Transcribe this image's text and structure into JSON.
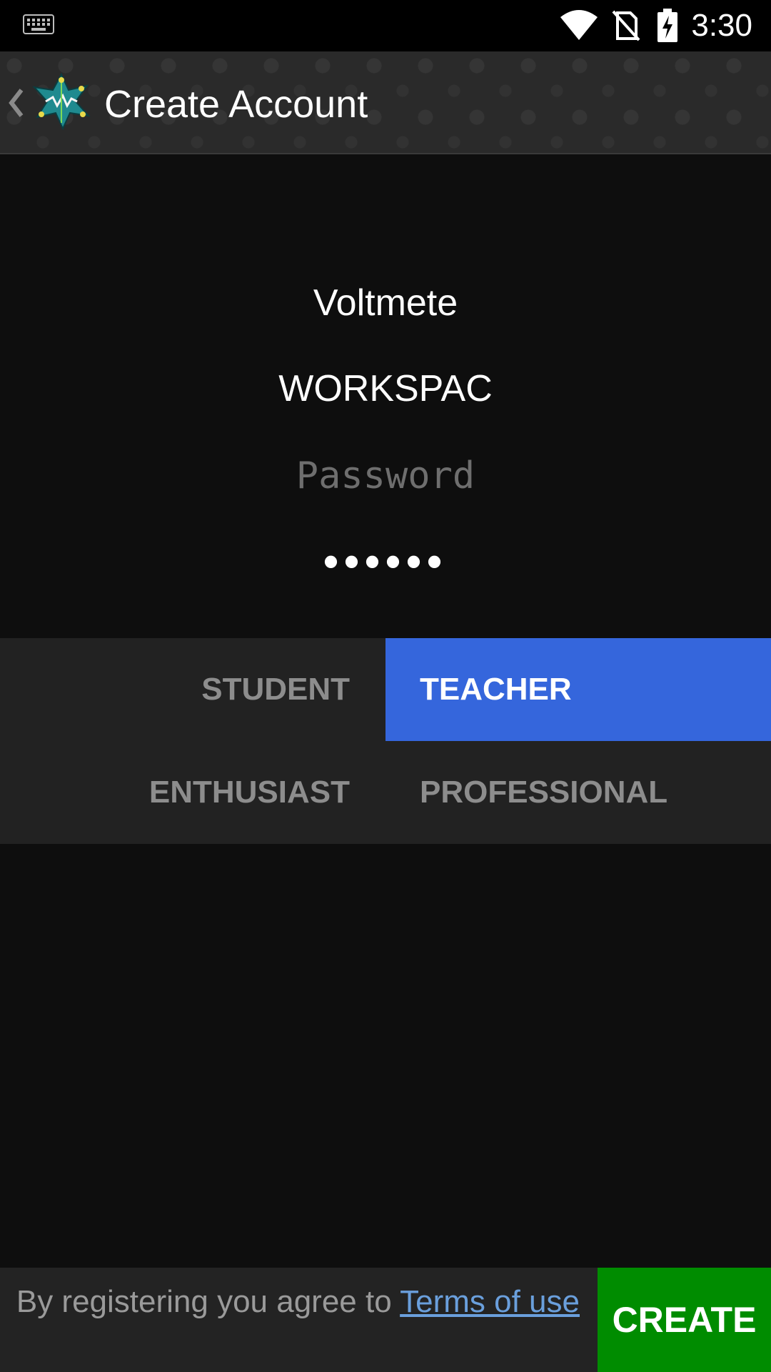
{
  "status_bar": {
    "time": "3:30",
    "icons": [
      "keyboard-icon",
      "wifi-icon",
      "no-sim-icon",
      "battery-charging-icon"
    ]
  },
  "app_bar": {
    "title": "Create Account",
    "back_icon": "chevron-left-icon",
    "logo_icon": "app-logo-icon"
  },
  "form": {
    "username_value": "Voltmete",
    "workspace_value": "WORKSPAC",
    "password_placeholder": "Password",
    "confirm_password_masked": "••••••"
  },
  "roles": {
    "items": [
      {
        "label": "STUDENT",
        "selected": false
      },
      {
        "label": "TEACHER",
        "selected": true
      },
      {
        "label": "ENTHUSIAST",
        "selected": false
      },
      {
        "label": "PROFESSIONAL",
        "selected": false
      }
    ]
  },
  "footer": {
    "terms_prefix": "By registering you agree to ",
    "terms_link": "Terms of use",
    "create_label": "CREATE"
  },
  "colors": {
    "accent_selected": "#3566dc",
    "create_button": "#008c00",
    "link": "#6a9fdc"
  }
}
